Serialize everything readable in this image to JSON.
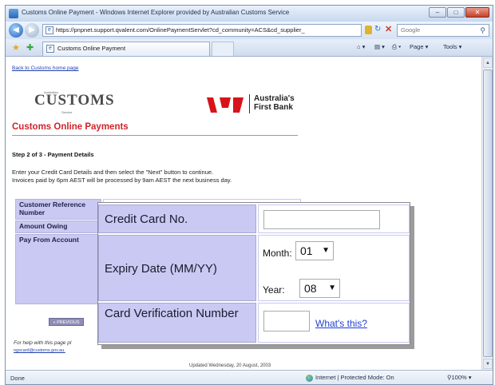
{
  "browser": {
    "window_title": "Customs Online Payment - Windows Internet Explorer provided by Australian Customs Service",
    "address": "https://pnpnet.support.qvalent.com/OnlinePaymentServlet?cd_community=ACS&cd_supplier_",
    "search_placeholder": "Google",
    "tab_title": "Customs Online Payment",
    "page_menu": "Page",
    "tools_menu": "Tools",
    "status": "Done",
    "zone": "Internet | Protected Mode: On",
    "zoom": "100%"
  },
  "page": {
    "back_link": "Back to Customs home page",
    "customs_logo": "CUSTOMS",
    "customs_logo_top": "Australian",
    "customs_logo_bottom": "Service",
    "bank_name_line1": "Australia's",
    "bank_name_line2": "First Bank",
    "heading": "Customs Online Payments",
    "step": "Step 2 of 3 - Payment Details",
    "instruction_line1": "Enter your Credit Card Details and then select the \"Next\" button to continue.",
    "instruction_line2": "Invoices paid by 6pm AEST will be processed by 9am AEST the next business day.",
    "labels": {
      "customer_reference": "Customer Reference Number",
      "amount_owing": "Amount Owing",
      "pay_from_account": "Pay From Account"
    },
    "previous_button": "« PREVIOUS",
    "help_text": "For help with this page pl",
    "help_email": "ngscard@customs.gov.au.",
    "updated": "Updated Wednesday, 20 August, 2003"
  },
  "zoom_panel": {
    "credit_card_label": "Credit Card No.",
    "credit_card_value": "",
    "expiry_label": "Expiry Date (MM/YY)",
    "month_label": "Month:",
    "month_value": "01",
    "year_label": "Year:",
    "year_value": "08",
    "cvv_label": "Card Verification Number",
    "cvv_value": "",
    "whats_this": "What's this?"
  },
  "colors": {
    "heading_red": "#d0242b",
    "label_bg": "#c9c9f3",
    "link_blue": "#1f3fd0",
    "bank_red": "#d7141a"
  }
}
